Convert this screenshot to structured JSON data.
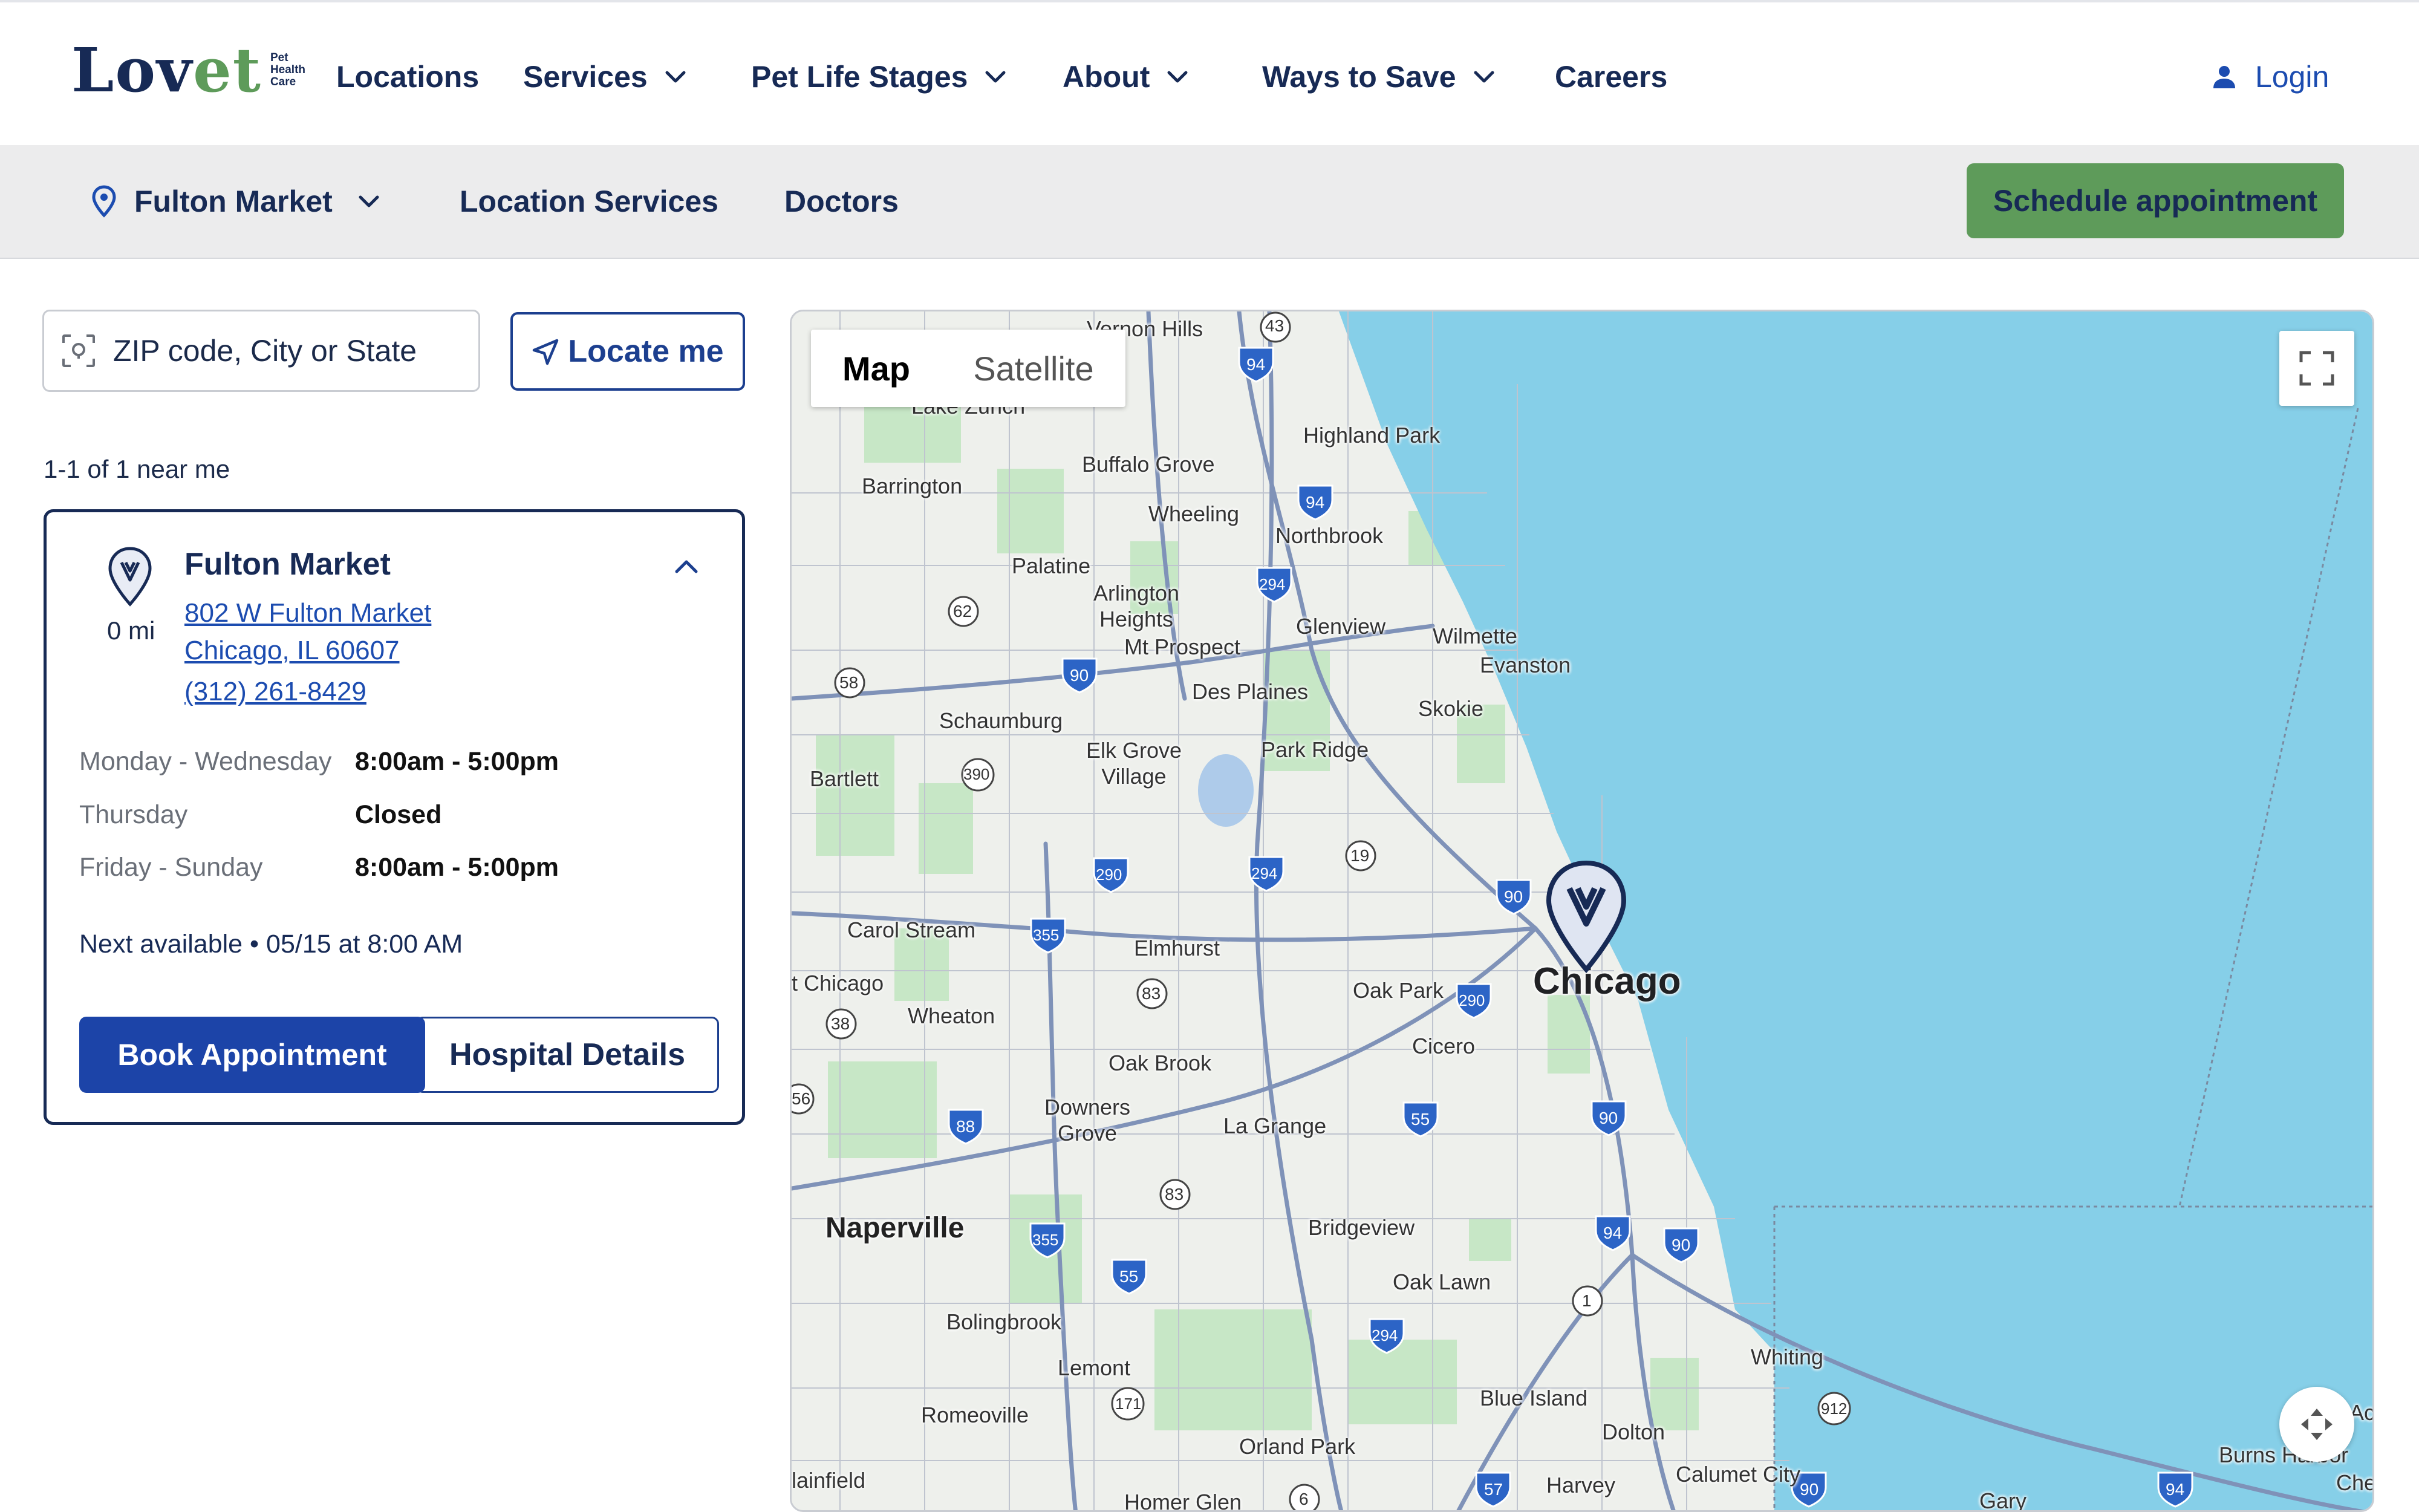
{
  "brand": {
    "name_part1": "Lov",
    "name_part2": "et",
    "tag_line1": "Pet",
    "tag_line2": "Health",
    "tag_line3": "Care"
  },
  "nav": {
    "locations": "Locations",
    "services": "Services",
    "pet_life_stages": "Pet Life Stages",
    "about": "About",
    "ways_to_save": "Ways to Save",
    "careers": "Careers",
    "login": "Login"
  },
  "subnav": {
    "location": "Fulton Market",
    "location_services": "Location Services",
    "doctors": "Doctors",
    "schedule": "Schedule appointment"
  },
  "search": {
    "placeholder": "ZIP code, City or State",
    "locate_label": "Locate me"
  },
  "results": {
    "count_text": "1-1 of 1 near me"
  },
  "location_card": {
    "name": "Fulton Market",
    "distance": "0 mi",
    "address_line1": "802 W Fulton Market",
    "address_line2": "Chicago, IL 60607",
    "phone": "(312) 261-8429",
    "hours": [
      {
        "day": "Monday - Wednesday",
        "time": "8:00am - 5:00pm"
      },
      {
        "day": "Thursday",
        "time": "Closed"
      },
      {
        "day": "Friday - Sunday",
        "time": "8:00am - 5:00pm"
      }
    ],
    "next_available": "Next available • 05/15 at 8:00 AM",
    "book_label": "Book Appointment",
    "details_label": "Hospital Details"
  },
  "map": {
    "tab_map": "Map",
    "tab_satellite": "Satellite",
    "labels": {
      "vernon_hills": "Vernon Hills",
      "lake_zurich": "Lake Zurich",
      "highland_park": "Highland Park",
      "buffalo_grove": "Buffalo Grove",
      "barrington": "Barrington",
      "wheeling": "Wheeling",
      "northbrook": "Northbrook",
      "palatine": "Palatine",
      "arlington_heights": "Arlington Heights",
      "glenview": "Glenview",
      "wilmette": "Wilmette",
      "mt_prospect": "Mt Prospect",
      "evanston": "Evanston",
      "des_plaines": "Des Plaines",
      "skokie": "Skokie",
      "schaumburg": "Schaumburg",
      "elk_grove": "Elk Grove Village",
      "park_ridge": "Park Ridge",
      "bartlett": "Bartlett",
      "carol_stream": "Carol Stream",
      "elmhurst": "Elmhurst",
      "chicago": "Chicago",
      "west_chicago": "t Chicago",
      "oak_park": "Oak Park",
      "wheaton": "Wheaton",
      "cicero": "Cicero",
      "oak_brook": "Oak Brook",
      "downers_grove": "Downers Grove",
      "la_grange": "La Grange",
      "naperville": "Naperville",
      "bridgeview": "Bridgeview",
      "oak_lawn": "Oak Lawn",
      "bolingbrook": "Bolingbrook",
      "whiting": "Whiting",
      "lemont": "Lemont",
      "romeoville": "Romeoville",
      "blue_island": "Blue Island",
      "dolton": "Dolton",
      "orland_park": "Orland Park",
      "burns_harbor": "Burns Harbor",
      "plainfield": "lainfield",
      "harvey": "Harvey",
      "calumet_city": "Calumet City",
      "homer_glen": "Homer Glen",
      "gary": "Gary",
      "ac": "Ac",
      "ches": "Ches"
    },
    "shields": {
      "s43": "43",
      "s94a": "94",
      "s94b": "94",
      "s294a": "294",
      "s62": "62",
      "s90a": "90",
      "s58": "58",
      "s390": "390",
      "s290a": "290",
      "s294b": "294",
      "s19": "19",
      "s90b": "90",
      "s355a": "355",
      "s83a": "83",
      "s290b": "290",
      "s38": "38",
      "s56": "56",
      "s88": "88",
      "s55a": "55",
      "s90c": "90",
      "s83b": "83",
      "s94c": "94",
      "s90d": "90",
      "s355b": "355",
      "s55b": "55",
      "s1": "1",
      "s294c": "294",
      "s171": "171",
      "s912": "912",
      "s57": "57",
      "s6": "6",
      "s90e": "90",
      "s94d": "94"
    }
  }
}
